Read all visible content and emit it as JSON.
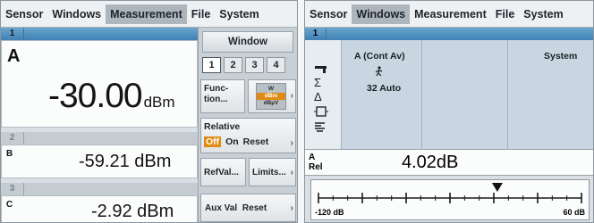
{
  "left_panel": {
    "menu": [
      {
        "label": "Sensor",
        "active": false
      },
      {
        "label": "Windows",
        "active": false
      },
      {
        "label": "Measurement",
        "active": true
      },
      {
        "label": "File",
        "active": false
      },
      {
        "label": "System",
        "active": false
      }
    ],
    "window1": {
      "number": "1",
      "channel": "A",
      "value": "-30.00",
      "unit": "dBm"
    },
    "window2": {
      "number": "2",
      "channel": "B",
      "value": "-59.21 dBm"
    },
    "window3": {
      "number": "3",
      "channel": "C",
      "value": "-2.92 dBm"
    },
    "softkeys": {
      "title": "Window",
      "tabs": [
        "1",
        "2",
        "3",
        "4"
      ],
      "selected_tab": "1",
      "function_label": "Func-\ntion...",
      "unit_options": [
        "W",
        "dBm",
        "dBµV"
      ],
      "unit_selected": "dBm",
      "relative_label": "Relative",
      "relative_off": "Off",
      "relative_on": "On",
      "relative_reset": "Reset",
      "refval_label": "RefVal...",
      "limits_label": "Limits...",
      "auxval_label": "Aux Val",
      "auxval_reset": "Reset"
    }
  },
  "right_panel": {
    "menu": [
      {
        "label": "Sensor",
        "active": false
      },
      {
        "label": "Windows",
        "active": true
      },
      {
        "label": "Measurement",
        "active": false
      },
      {
        "label": "File",
        "active": false
      },
      {
        "label": "System",
        "active": false
      }
    ],
    "window_number": "1",
    "config": {
      "col1_title": "A  (Cont Av)",
      "col1_value": "32  Auto",
      "col3_title": "System"
    },
    "icons": [
      "gun-icon",
      "sigma-icon",
      "delta-icon",
      "frame-icon",
      "filter-icon"
    ],
    "reading": {
      "channel": "A",
      "mode": "Rel",
      "value": "4.02dB"
    },
    "scale": {
      "min_label": "-120 dB",
      "max_label": "60 dB",
      "marker_fraction": 0.68
    }
  }
}
